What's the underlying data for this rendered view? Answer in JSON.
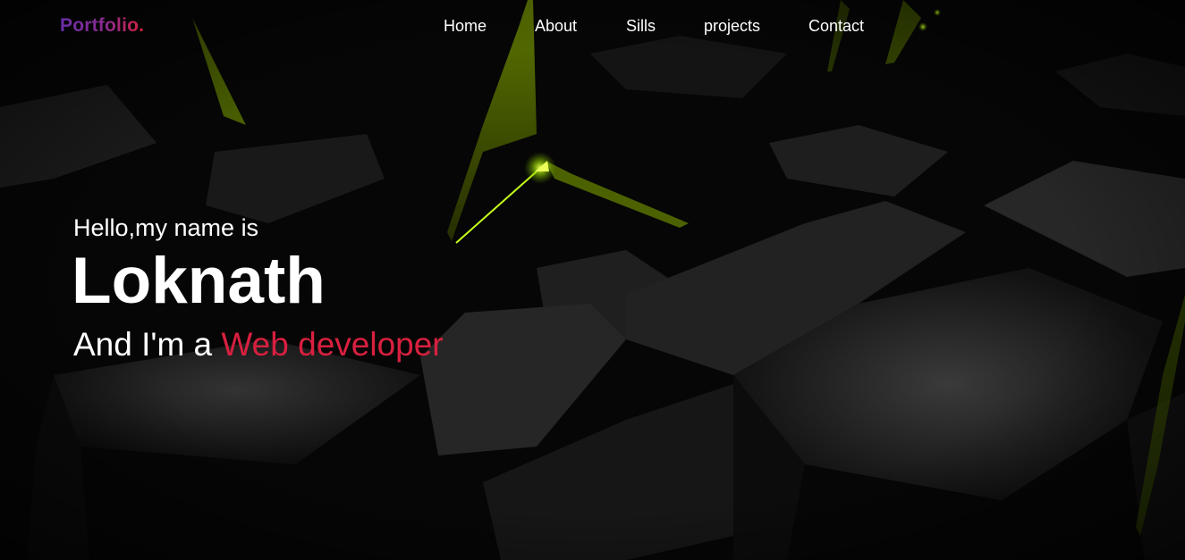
{
  "brand": {
    "logo_part1": "Portfo",
    "logo_part2": "lio."
  },
  "nav": {
    "items": [
      {
        "label": "Home"
      },
      {
        "label": "About"
      },
      {
        "label": "Sills"
      },
      {
        "label": "projects"
      },
      {
        "label": "Contact"
      }
    ]
  },
  "hero": {
    "greeting": "Hello,my name is",
    "name": "Loknath",
    "tagline_prefix": "And I'm a ",
    "role": "Web developer"
  },
  "colors": {
    "logo_gradient_start": "#6a2ea8",
    "logo_gradient_end": "#d3213f",
    "accent": "#d8203f",
    "text": "#ffffff",
    "background": "#050505",
    "highlight_green": "#b8ff1a"
  }
}
